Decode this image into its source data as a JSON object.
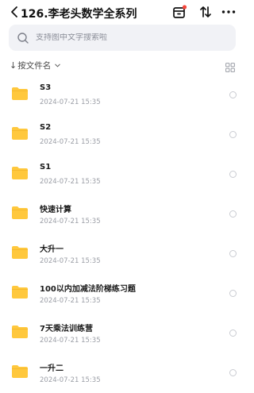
{
  "header": {
    "title": "126.李老头数学全系列"
  },
  "search": {
    "placeholder": "支持图中文字搜索啦"
  },
  "sort": {
    "label": "按文件名"
  },
  "colors": {
    "folder": "#FFC83D",
    "badge": "#F5463C",
    "search_bg": "#F1F2F6"
  },
  "files": [
    {
      "name": "S3",
      "date": "2024-07-21 15:35"
    },
    {
      "name": "S2",
      "date": "2024-07-21 15:35"
    },
    {
      "name": "S1",
      "date": "2024-07-21 15:35"
    },
    {
      "name": "快速计算",
      "date": "2024-07-21 15:35"
    },
    {
      "name": "大升一",
      "date": "2024-07-21 15:35"
    },
    {
      "name": "100以内加减法阶梯练习题",
      "date": "2024-07-21 15:35"
    },
    {
      "name": "7天乘法训练营",
      "date": "2024-07-21 15:35"
    },
    {
      "name": "一升二",
      "date": "2024-07-21 15:35"
    }
  ]
}
